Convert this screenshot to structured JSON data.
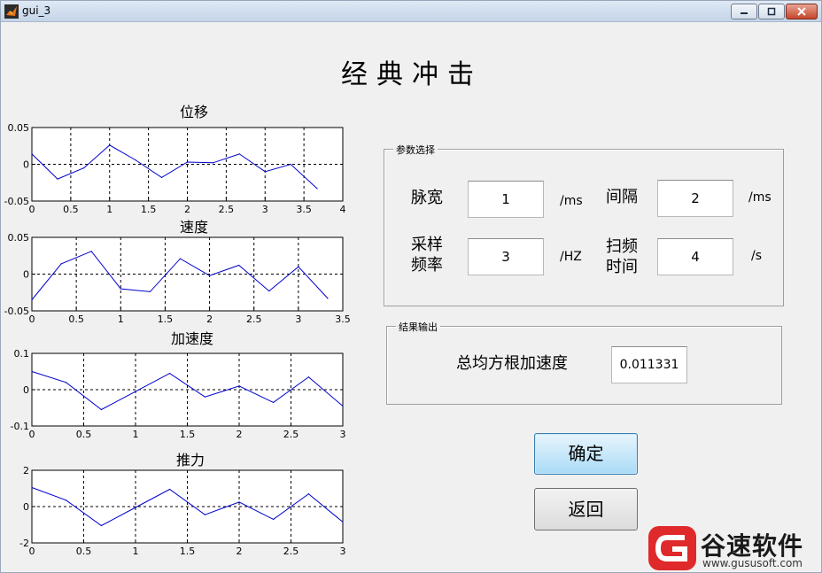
{
  "window": {
    "title": "gui_3"
  },
  "main_title": "经典冲击",
  "plots": [
    {
      "title": "位移",
      "chart_data": {
        "type": "line",
        "xlim": [
          0,
          4
        ],
        "ylim": [
          -0.05,
          0.05
        ],
        "xticks": [
          "0",
          "0.5",
          "1",
          "1.5",
          "2",
          "2.5",
          "3",
          "3.5",
          "4"
        ],
        "yticks": [
          "0.05",
          "0",
          "-0.05"
        ],
        "x": [
          0,
          0.33,
          0.67,
          1.0,
          1.33,
          1.67,
          2.0,
          2.33,
          2.67,
          3.0,
          3.33,
          3.67
        ],
        "y": [
          0.014,
          -0.02,
          -0.005,
          0.026,
          0.006,
          -0.018,
          0.003,
          0.002,
          0.014,
          -0.01,
          0.0,
          -0.033
        ],
        "grid": true
      }
    },
    {
      "title": "速度",
      "chart_data": {
        "type": "line",
        "xlim": [
          0,
          3.5
        ],
        "ylim": [
          -0.05,
          0.05
        ],
        "xticks": [
          "0",
          "0.5",
          "1",
          "1.5",
          "2",
          "2.5",
          "3",
          "3.5"
        ],
        "yticks": [
          "0.05",
          "0",
          "-0.05"
        ],
        "x": [
          0,
          0.33,
          0.67,
          1.0,
          1.33,
          1.67,
          2.0,
          2.33,
          2.67,
          3.0,
          3.33
        ],
        "y": [
          -0.035,
          0.014,
          0.031,
          -0.02,
          -0.024,
          0.021,
          -0.002,
          0.012,
          -0.023,
          0.01,
          -0.033
        ],
        "grid": true
      }
    },
    {
      "title": "加速度",
      "chart_data": {
        "type": "line",
        "xlim": [
          0,
          3
        ],
        "ylim": [
          -0.1,
          0.1
        ],
        "xticks": [
          "0",
          "0.5",
          "1",
          "1.5",
          "2",
          "2.5",
          "3"
        ],
        "yticks": [
          "0.1",
          "0",
          "-0.1"
        ],
        "x": [
          0,
          0.33,
          0.67,
          1.0,
          1.33,
          1.67,
          2.0,
          2.33,
          2.67,
          3.0
        ],
        "y": [
          0.05,
          0.02,
          -0.055,
          -0.005,
          0.045,
          -0.02,
          0.01,
          -0.035,
          0.035,
          -0.045
        ],
        "grid": true
      }
    },
    {
      "title": "推力",
      "chart_data": {
        "type": "line",
        "xlim": [
          0,
          3
        ],
        "ylim": [
          -2,
          2
        ],
        "xticks": [
          "0",
          "0.5",
          "1",
          "1.5",
          "2",
          "2.5",
          "3"
        ],
        "yticks": [
          "2",
          "0",
          "-2"
        ],
        "x": [
          0,
          0.33,
          0.67,
          1.0,
          1.33,
          1.67,
          2.0,
          2.33,
          2.67,
          3.0
        ],
        "y": [
          1.05,
          0.35,
          -1.05,
          -0.05,
          0.95,
          -0.45,
          0.25,
          -0.7,
          0.7,
          -0.85
        ],
        "grid": true
      }
    }
  ],
  "params_panel": {
    "title": "参数选择",
    "pulse_width": {
      "label": "脉宽",
      "value": "1",
      "unit": "/ms"
    },
    "interval": {
      "label": "间隔",
      "value": "2",
      "unit": "/ms"
    },
    "sample_rate": {
      "label_line1": "采样",
      "label_line2": "频率",
      "value": "3",
      "unit": "/HZ"
    },
    "sweep_time": {
      "label_line1": "扫频",
      "label_line2": "时间",
      "value": "4",
      "unit": "/s"
    }
  },
  "result_panel": {
    "title": "结果输出",
    "rms_label": "总均方根加速度",
    "rms_value": "0.011331"
  },
  "buttons": {
    "ok": "确定",
    "back": "返回"
  },
  "watermark": {
    "brand": "谷速软件",
    "url": "www.gususoft.com"
  },
  "colors": {
    "plot_line": "#0000cc",
    "ok_button": "#a9dbf6",
    "close_button": "#c7452a",
    "brand_red": "#e0292a"
  },
  "icons": {
    "app": "matlab-icon",
    "min": "minimize-icon",
    "max": "maximize-icon",
    "close": "close-icon"
  }
}
